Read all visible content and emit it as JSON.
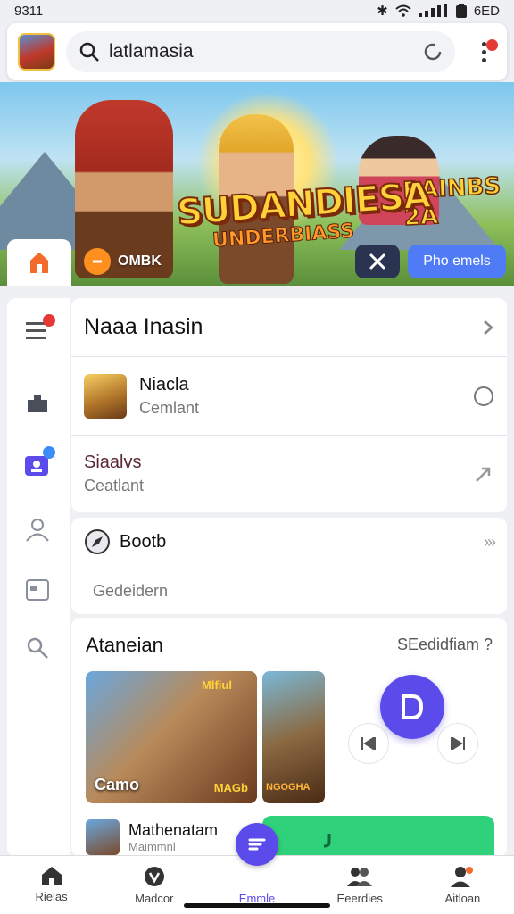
{
  "status": {
    "time": "9311",
    "battery": "6ED"
  },
  "search": {
    "query": "latlamasia"
  },
  "banner": {
    "title": "SUDANDIESA",
    "subtitle": "UNDERBIASS",
    "corner_logo": "BAINBS 2A",
    "chip_label": "OMBK",
    "pill_label": "Pho emels"
  },
  "list": {
    "header": "Naaa Inasin",
    "item1": {
      "title": "Niacla",
      "subtitle": "Cemlant"
    },
    "item2": {
      "title": "Siaalvs",
      "subtitle": "Ceatlant"
    },
    "item3": {
      "title": "Bootb",
      "subtitle": "Gedeidern"
    }
  },
  "media": {
    "title": "Ataneian",
    "link": "SEedidfiam ?",
    "tile1": {
      "label": "Camo",
      "tag": "MAGb",
      "badge": "Mlfiul"
    },
    "tile2": {
      "label": "NGOGHA"
    },
    "footer_title": "Mathenatam",
    "footer_sub": "Maimmnl"
  },
  "nav": [
    {
      "label": "Rielas",
      "icon": "home-icon"
    },
    {
      "label": "Madcor",
      "icon": "shield-icon"
    },
    {
      "label": "Emmle",
      "icon": "chat-icon"
    },
    {
      "label": "Eeerdies",
      "icon": "friends-icon"
    },
    {
      "label": "Aitloan",
      "icon": "profile-icon"
    }
  ],
  "colors": {
    "accent": "#5b4bea",
    "pill": "#4f7cf6",
    "green": "#2fd27a",
    "badge_red": "#e53935"
  }
}
